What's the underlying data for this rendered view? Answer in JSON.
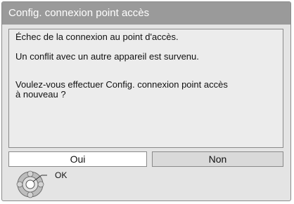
{
  "dialog": {
    "title": "Config. connexion point accès",
    "messages": {
      "line1": "Échec de la connexion au point d'accès.",
      "line2": "Un conflit avec un autre appareil est survenu.",
      "line3": "Voulez-vous effectuer Config. connexion point accès",
      "line4": "à nouveau ?"
    },
    "buttons": {
      "yes_label": "Oui",
      "no_label": "Non",
      "focused": "Oui"
    }
  },
  "hint": {
    "ok_label": "OK",
    "icon": "remote-dpad-icon"
  },
  "colors": {
    "title_bar": "#9a9a9a",
    "dialog_bg": "#e4e4e4",
    "message_bg": "#ececec",
    "selected_button": "#ffffff",
    "unselected_button": "#d9d9d9"
  }
}
